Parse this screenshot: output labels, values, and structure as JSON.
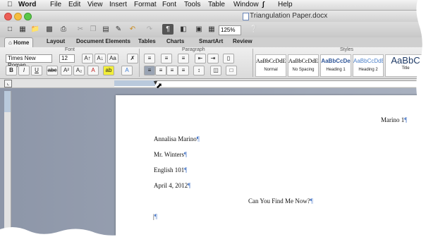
{
  "menubar": {
    "apple": "",
    "app": "Word",
    "items": [
      "File",
      "Edit",
      "View",
      "Insert",
      "Format",
      "Font",
      "Tools",
      "Table",
      "Window",
      "Help"
    ]
  },
  "window": {
    "title": "Triangulation Paper.docx"
  },
  "toolbar": {
    "zoom": "125%"
  },
  "ribbon": {
    "tabs": [
      "Home",
      "Layout",
      "Document Elements",
      "Tables",
      "Charts",
      "SmartArt",
      "Review"
    ],
    "groups": {
      "font": "Font",
      "paragraph": "Paragraph",
      "styles": "Styles"
    },
    "font_name": "Times New Roman",
    "font_size": "12",
    "styles": [
      {
        "sample": "AaBbCcDdE",
        "name": "Normal"
      },
      {
        "sample": "AaBbCcDdE",
        "name": "No Spacing"
      },
      {
        "sample": "AaBbCcDe",
        "name": "Heading 1"
      },
      {
        "sample": "AaBbCcDdEe",
        "name": "Heading 2"
      },
      {
        "sample": "AaBbC",
        "name": "Title"
      }
    ]
  },
  "document": {
    "header": "Marino 1",
    "lines": [
      "Annalisa Marino",
      "Mr. Winters",
      "English 101",
      "April 4, 2012"
    ],
    "title": "Can You Find Me Now?",
    "pilcrow": "¶"
  },
  "colors": {
    "traffic_red": "#ec5f57",
    "traffic_yellow": "#f5bd3f",
    "traffic_green": "#5ac748",
    "formatting_mark": "#4a78c8"
  }
}
